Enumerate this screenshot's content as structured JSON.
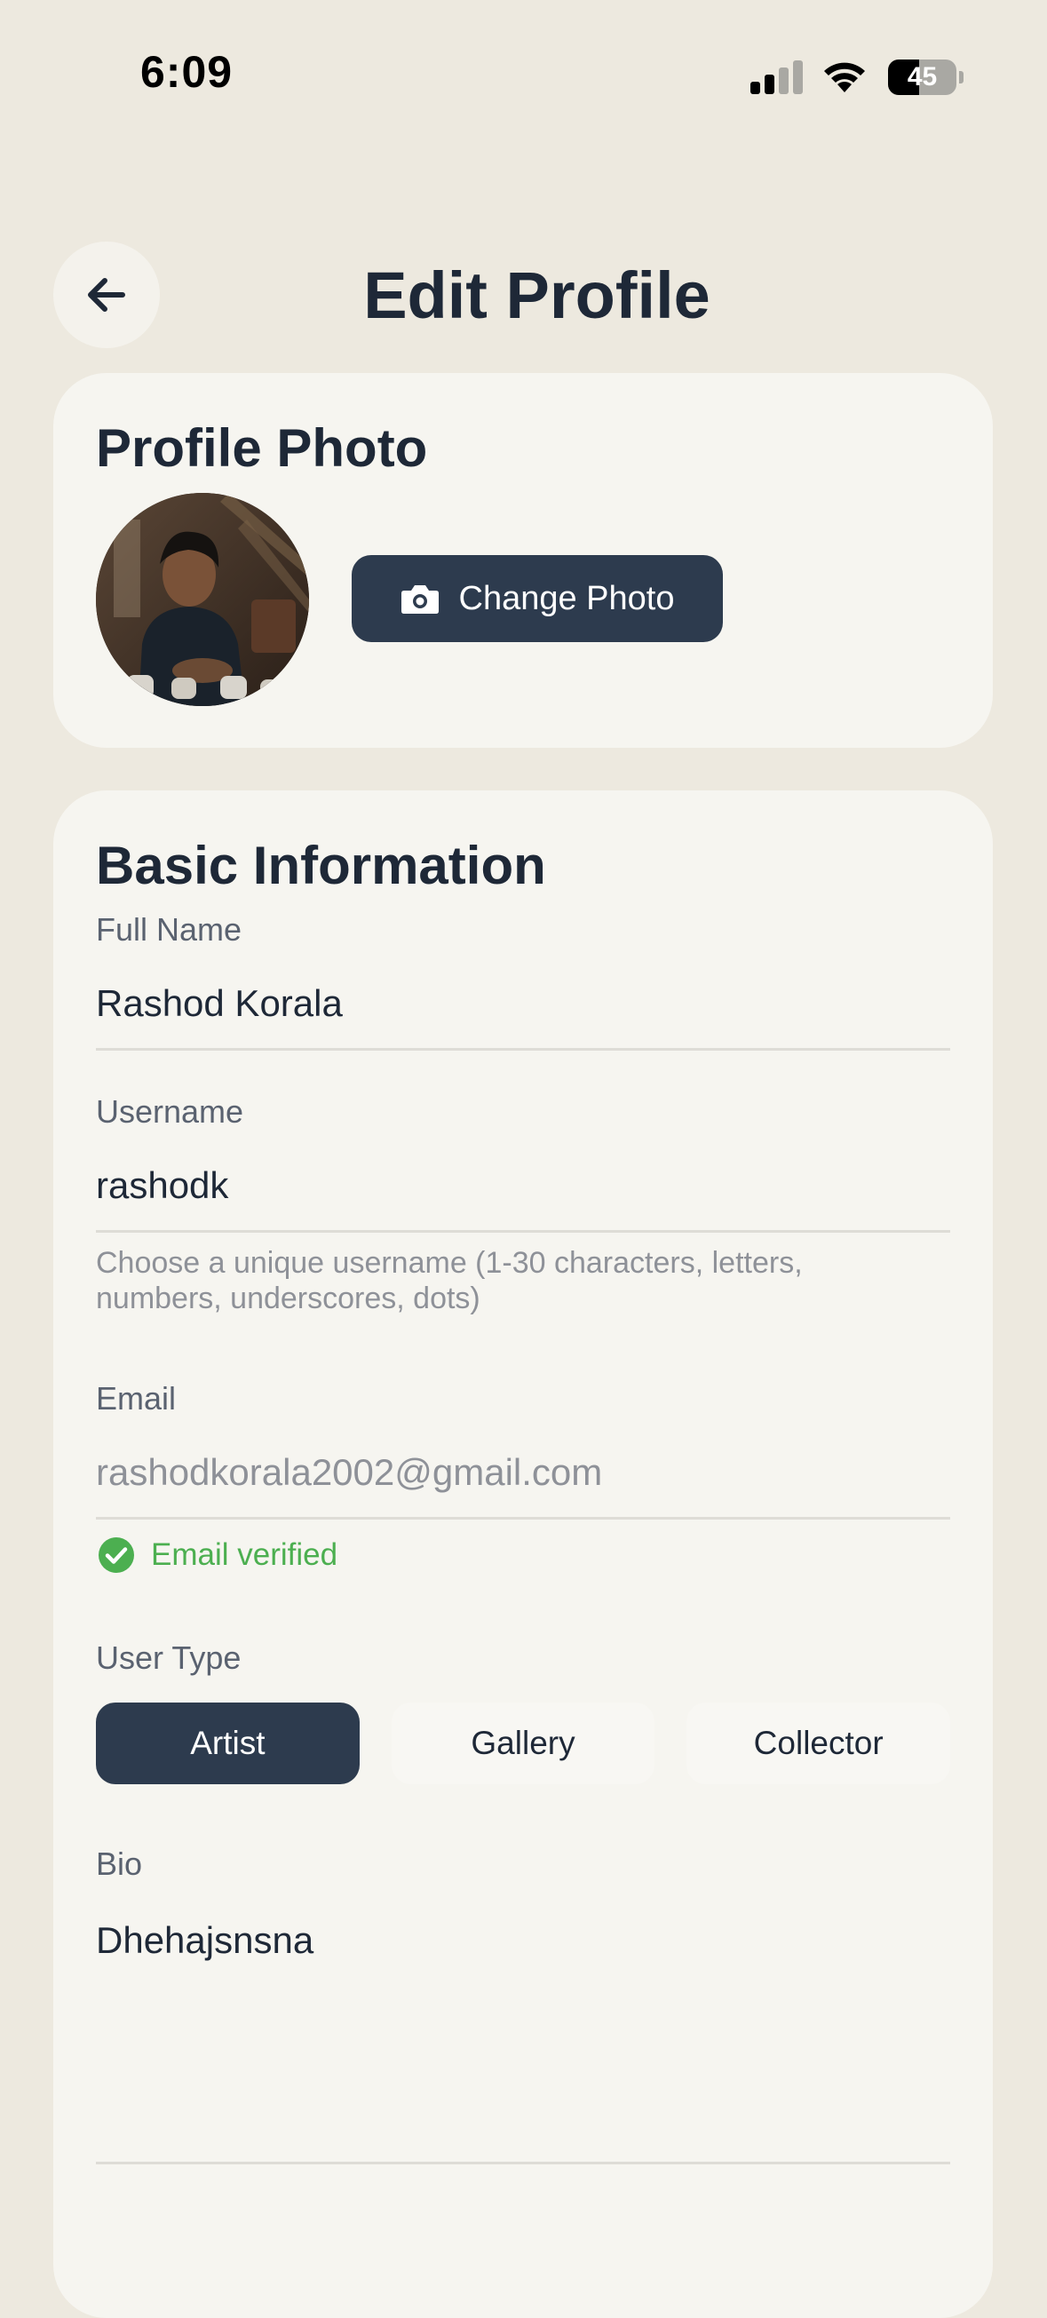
{
  "status_bar": {
    "time": "6:09",
    "battery_percent": 45,
    "battery_label": "45",
    "signal_bars_active": 2,
    "signal_bars_total": 4
  },
  "header": {
    "title": "Edit Profile",
    "back_icon": "arrow-left-icon"
  },
  "profile_photo": {
    "section_title": "Profile Photo",
    "change_button_label": "Change Photo",
    "button_icon": "camera-icon"
  },
  "basic_info": {
    "section_title": "Basic Information",
    "full_name": {
      "label": "Full Name",
      "value": "Rashod Korala"
    },
    "username": {
      "label": "Username",
      "value": "rashodk",
      "helper": "Choose a unique username (1-30 characters, letters, numbers, underscores, dots)"
    },
    "email": {
      "label": "Email",
      "value": "rashodkorala2002@gmail.com",
      "verified_text": "Email verified",
      "verified_icon": "check-circle-icon"
    },
    "user_type": {
      "label": "User Type",
      "options": [
        "Artist",
        "Gallery",
        "Collector"
      ],
      "selected": "Artist"
    },
    "bio": {
      "label": "Bio",
      "value": "Dhehajsnsna"
    }
  },
  "colors": {
    "background": "#EDE9DF",
    "card": "#F6F5F0",
    "primary": "#2D3B4E",
    "text": "#1E2837",
    "verified_green": "#4CAF50"
  }
}
